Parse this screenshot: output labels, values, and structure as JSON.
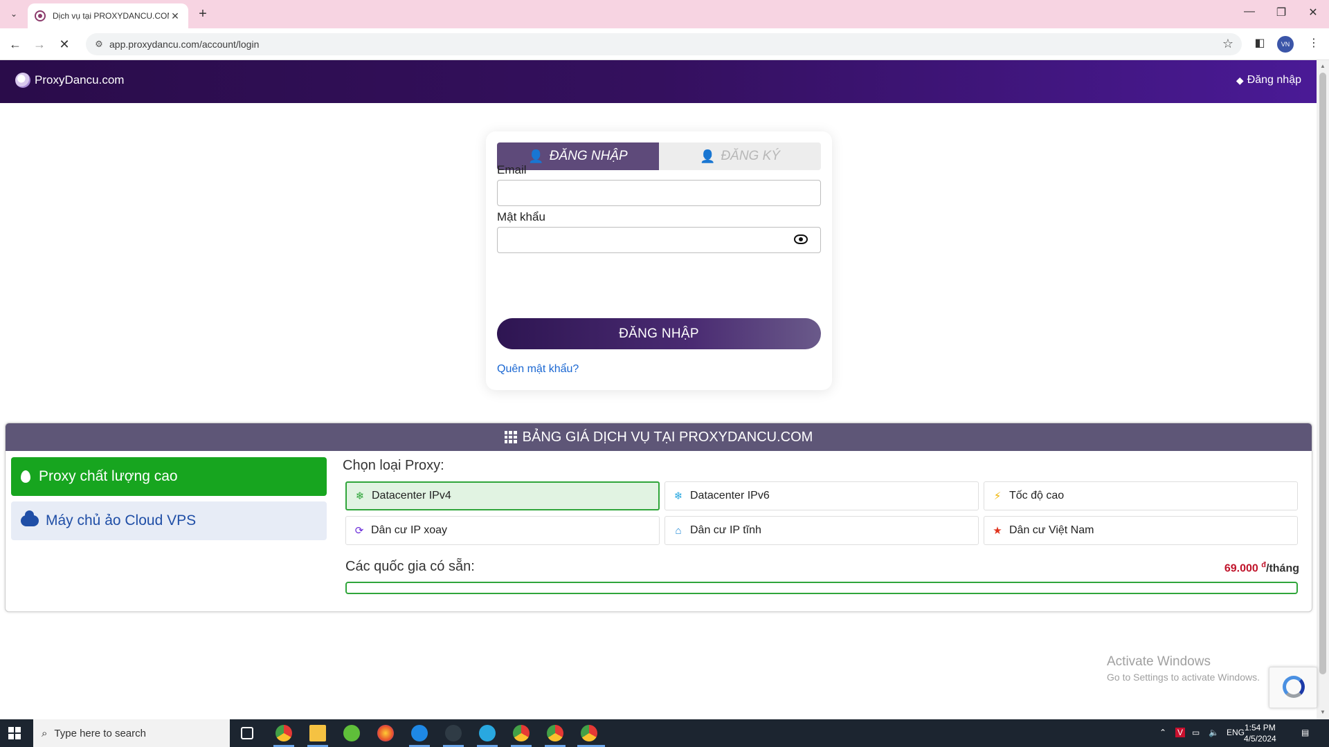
{
  "browser": {
    "tab_title": "Dịch vụ tại PROXYDANCU.COM",
    "url": "app.proxydancu.com/account/login",
    "profile_initials": "VN"
  },
  "header": {
    "brand": "ProxyDancu.com",
    "login_link": "Đăng nhập"
  },
  "auth": {
    "tab_login": "ĐĂNG NHẬP",
    "tab_register": "ĐĂNG KÝ",
    "email_label": "Email",
    "password_label": "Mật khẩu",
    "submit_label": "ĐĂNG NHẬP",
    "forgot_label": "Quên mật khẩu?"
  },
  "pricing": {
    "title": "BẢNG GIÁ DỊCH VỤ TẠI PROXYDANCU.COM",
    "categories": [
      {
        "label": "Proxy chất lượng cao",
        "active": true
      },
      {
        "label": "Máy chủ ảo Cloud VPS",
        "active": false
      }
    ],
    "choose_label": "Chọn loại Proxy:",
    "options": [
      {
        "label": "Datacenter IPv4",
        "icon": "snowflake-icon",
        "color": "#2fa53a",
        "selected": true
      },
      {
        "label": "Datacenter IPv6",
        "icon": "snowflake-icon",
        "color": "#29a8e0",
        "selected": false
      },
      {
        "label": "Tốc độ cao",
        "icon": "bolt-icon",
        "color": "#f0b400",
        "selected": false
      },
      {
        "label": "Dân cư IP xoay",
        "icon": "rotate-icon",
        "color": "#6a2bd9",
        "selected": false
      },
      {
        "label": "Dân cư IP tĩnh",
        "icon": "home-icon",
        "color": "#1f88d6",
        "selected": false
      },
      {
        "label": "Dân cư Việt Nam",
        "icon": "star-icon",
        "color": "#e0321c",
        "selected": false
      }
    ],
    "countries_label": "Các quốc gia có sẵn:",
    "price_value": "69.000",
    "price_currency": "đ",
    "price_unit": "/tháng"
  },
  "watermark": {
    "title": "Activate Windows",
    "subtitle": "Go to Settings to activate Windows."
  },
  "taskbar": {
    "search_placeholder": "Type here to search",
    "language": "ENG",
    "time": "1:54 PM",
    "date": "4/5/2024"
  }
}
